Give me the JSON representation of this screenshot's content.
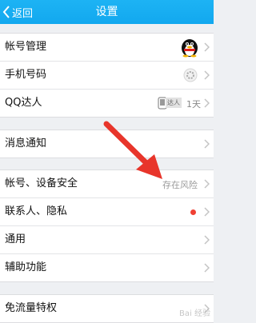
{
  "header": {
    "back_label": "返回",
    "title": "设置"
  },
  "group1": [
    {
      "label": "帐号管理"
    },
    {
      "label": "手机号码"
    },
    {
      "label": "QQ达人",
      "badge": "达人",
      "days": "1天"
    }
  ],
  "group2": [
    {
      "label": "消息通知"
    }
  ],
  "group3": [
    {
      "label": "帐号、设备安全",
      "status": "存在风险"
    },
    {
      "label": "联系人、隐私"
    },
    {
      "label": "通用"
    },
    {
      "label": "辅助功能"
    }
  ],
  "group4": [
    {
      "label": "免流量特权"
    }
  ],
  "watermark": "Bai 经验",
  "colors": {
    "header": "#12a8ef",
    "red_dot": "#f04033",
    "arrow": "#e8352b"
  },
  "icons": [
    "back-chevron-icon",
    "qq-avatar-icon",
    "loading-spinner-icon",
    "qq-talent-badge-icon",
    "chevron-right-icon",
    "red-arrow-annotation"
  ]
}
